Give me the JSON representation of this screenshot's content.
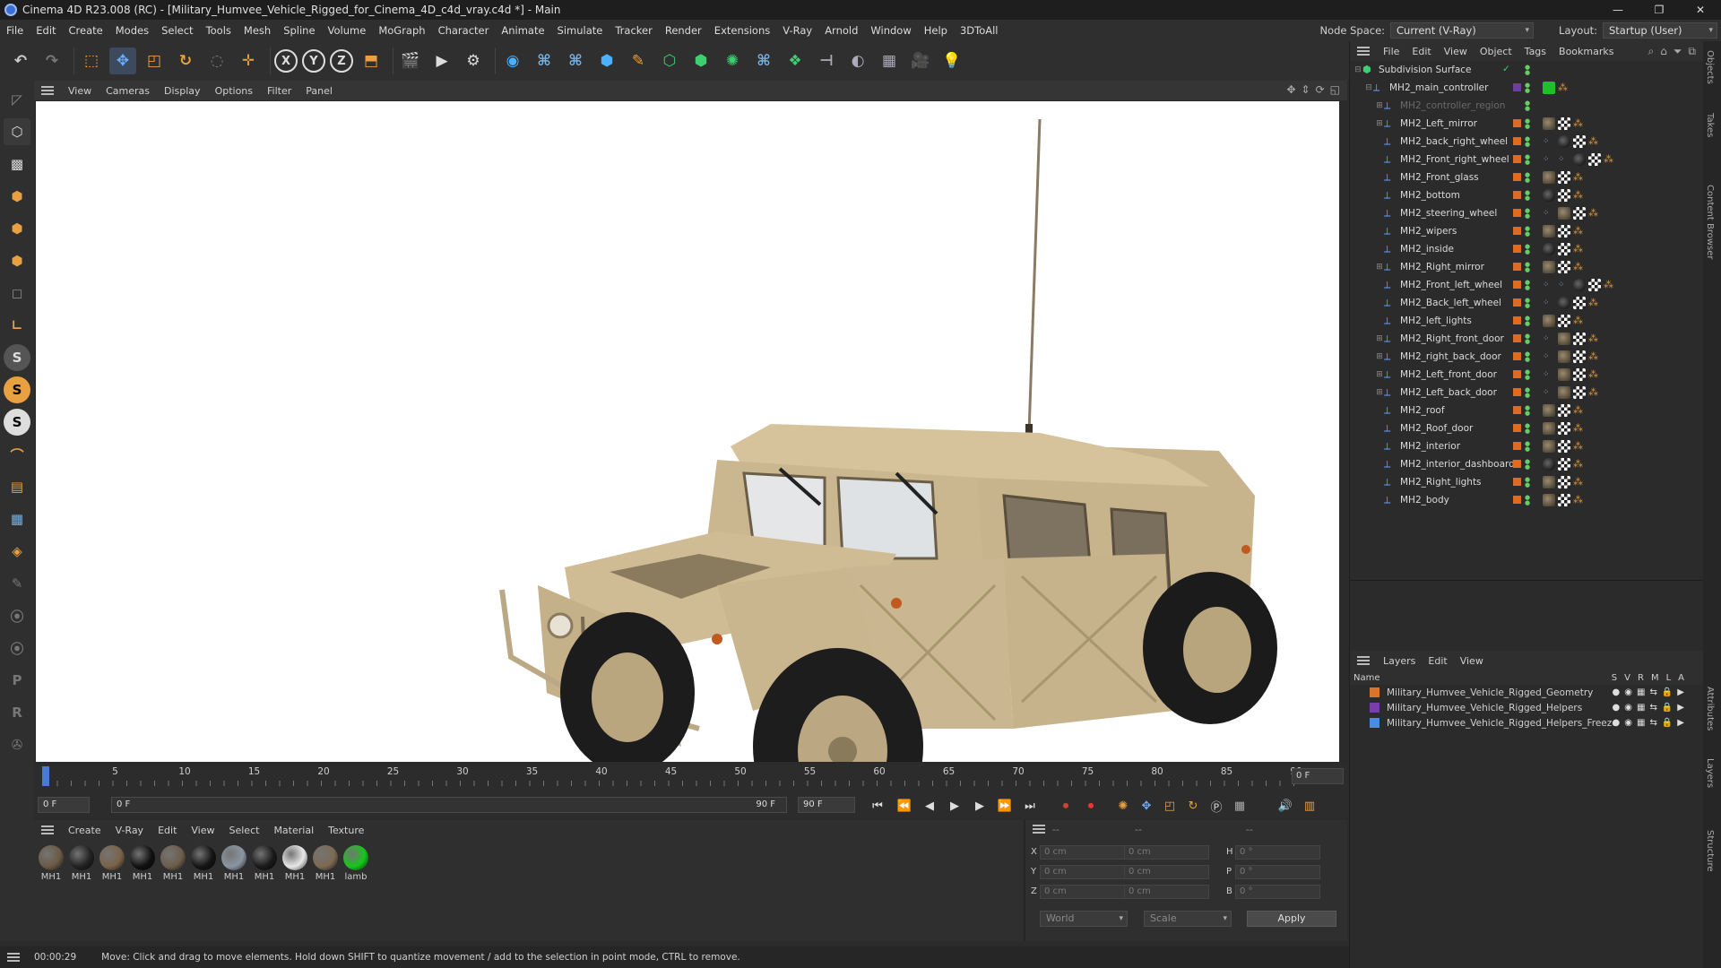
{
  "window": {
    "title": "Cinema 4D R23.008 (RC) - [Military_Humvee_Vehicle_Rigged_for_Cinema_4D_c4d_vray.c4d *] - Main"
  },
  "menu": [
    "File",
    "Edit",
    "Create",
    "Modes",
    "Select",
    "Tools",
    "Mesh",
    "Spline",
    "Volume",
    "MoGraph",
    "Character",
    "Animate",
    "Simulate",
    "Tracker",
    "Render",
    "Extensions",
    "V-Ray",
    "Arnold",
    "Window",
    "Help",
    "3DToAll"
  ],
  "node_space": {
    "label": "Node Space:",
    "value": "Current (V-Ray)"
  },
  "layout": {
    "label": "Layout:",
    "value": "Startup (User)"
  },
  "viewport_menu": [
    "View",
    "Cameras",
    "Display",
    "Options",
    "Filter",
    "Panel"
  ],
  "timeline": {
    "ticks": [
      "0",
      "5",
      "10",
      "15",
      "20",
      "25",
      "30",
      "35",
      "40",
      "45",
      "50",
      "55",
      "60",
      "65",
      "70",
      "75",
      "80",
      "85",
      "90"
    ],
    "frame": "0 F"
  },
  "playback": {
    "start": "0 F",
    "current": "0 F",
    "end_slider": "90 F",
    "end": "90 F"
  },
  "material_menu": [
    "Create",
    "V-Ray",
    "Edit",
    "View",
    "Select",
    "Material",
    "Texture"
  ],
  "materials": [
    {
      "label": "MH1",
      "color": "#6b5a45"
    },
    {
      "label": "MH1",
      "color": "#222"
    },
    {
      "label": "MH1",
      "color": "#7a6248"
    },
    {
      "label": "MH1",
      "color": "#111"
    },
    {
      "label": "MH1",
      "color": "#6d5d4b"
    },
    {
      "label": "MH1",
      "color": "#151515"
    },
    {
      "label": "MH1",
      "color": "#8a96a2"
    },
    {
      "label": "MH1",
      "color": "#1a1a1a"
    },
    {
      "label": "MH1",
      "color": "#e8e8e8"
    },
    {
      "label": "MH1",
      "color": "#7d6a52"
    },
    {
      "label": "lamb",
      "color": "#17c61c"
    }
  ],
  "coords": {
    "rows": [
      {
        "a1": "X",
        "v1": "0 cm",
        "a2": "X",
        "v2": "0 cm",
        "a3": "H",
        "v3": "0 °"
      },
      {
        "a1": "Y",
        "v1": "0 cm",
        "a2": "Y",
        "v2": "0 cm",
        "a3": "P",
        "v3": "0 °"
      },
      {
        "a1": "Z",
        "v1": "0 cm",
        "a2": "Z",
        "v2": "0 cm",
        "a3": "B",
        "v3": "0 °"
      }
    ],
    "head1": "--",
    "head2": "--",
    "head3": "--",
    "world": "World",
    "scale": "Scale",
    "apply": "Apply"
  },
  "status": {
    "time": "00:00:29",
    "message": "Move: Click and drag to move elements. Hold down SHIFT to quantize movement / add to the selection in point mode, CTRL to remove."
  },
  "object_menu": [
    "File",
    "Edit",
    "View",
    "Object",
    "Tags",
    "Bookmarks"
  ],
  "objects": [
    {
      "name": "Subdivision Surface",
      "indent": 0,
      "exp": "⊟",
      "sw": false,
      "tags": []
    },
    {
      "name": "MH2_main_controller",
      "indent": 1,
      "exp": "⊟",
      "sw": "#6a3fa0",
      "tags": [
        "green",
        "dot"
      ]
    },
    {
      "name": "MH2_controller_region",
      "indent": 2,
      "exp": "⊞",
      "sw": false,
      "dim": true,
      "tags": []
    },
    {
      "name": "MH2_Left_mirror",
      "indent": 2,
      "exp": "⊞",
      "tags": [
        "mat",
        "chk",
        "dot"
      ]
    },
    {
      "name": "MH2_back_right_wheel",
      "indent": 2,
      "exp": "",
      "tags": [
        "grid",
        "dark",
        "chk",
        "dot"
      ]
    },
    {
      "name": "MH2_Front_right_wheel",
      "indent": 2,
      "exp": "",
      "tags": [
        "grid",
        "grid",
        "dark",
        "chk",
        "dot"
      ]
    },
    {
      "name": "MH2_Front_glass",
      "indent": 2,
      "exp": "",
      "tags": [
        "mat",
        "chk",
        "dot"
      ]
    },
    {
      "name": "MH2_bottom",
      "indent": 2,
      "exp": "",
      "tags": [
        "dark",
        "chk",
        "dot"
      ]
    },
    {
      "name": "MH2_steering_wheel",
      "indent": 2,
      "exp": "",
      "tags": [
        "grid",
        "mat",
        "chk",
        "dot"
      ]
    },
    {
      "name": "MH2_wipers",
      "indent": 2,
      "exp": "",
      "tags": [
        "mat",
        "chk",
        "dot"
      ]
    },
    {
      "name": "MH2_inside",
      "indent": 2,
      "exp": "",
      "tags": [
        "dark",
        "chk",
        "dot"
      ]
    },
    {
      "name": "MH2_Right_mirror",
      "indent": 2,
      "exp": "⊞",
      "tags": [
        "mat",
        "chk",
        "dot"
      ]
    },
    {
      "name": "MH2_Front_left_wheel",
      "indent": 2,
      "exp": "",
      "tags": [
        "grid",
        "grid",
        "dark",
        "chk",
        "dot"
      ]
    },
    {
      "name": "MH2_Back_left_wheel",
      "indent": 2,
      "exp": "",
      "tags": [
        "grid",
        "dark",
        "chk",
        "dot"
      ]
    },
    {
      "name": "MH2_left_lights",
      "indent": 2,
      "exp": "",
      "tags": [
        "mat",
        "chk",
        "dot"
      ]
    },
    {
      "name": "MH2_Right_front_door",
      "indent": 2,
      "exp": "⊞",
      "tags": [
        "grid",
        "mat",
        "chk",
        "dot"
      ]
    },
    {
      "name": "MH2_right_back_door",
      "indent": 2,
      "exp": "⊞",
      "tags": [
        "grid",
        "mat",
        "chk",
        "dot"
      ]
    },
    {
      "name": "MH2_Left_front_door",
      "indent": 2,
      "exp": "⊞",
      "tags": [
        "grid",
        "mat",
        "chk",
        "dot"
      ]
    },
    {
      "name": "MH2_Left_back_door",
      "indent": 2,
      "exp": "⊞",
      "tags": [
        "grid",
        "mat",
        "chk",
        "dot"
      ]
    },
    {
      "name": "MH2_roof",
      "indent": 2,
      "exp": "",
      "tags": [
        "mat",
        "chk",
        "dot"
      ]
    },
    {
      "name": "MH2_Roof_door",
      "indent": 2,
      "exp": "",
      "tags": [
        "mat",
        "chk",
        "dot"
      ]
    },
    {
      "name": "MH2_interior",
      "indent": 2,
      "exp": "",
      "tags": [
        "mat",
        "chk",
        "dot"
      ]
    },
    {
      "name": "MH2_interior_dashboard",
      "indent": 2,
      "exp": "",
      "tags": [
        "dark",
        "chk",
        "dot"
      ]
    },
    {
      "name": "MH2_Right_lights",
      "indent": 2,
      "exp": "",
      "tags": [
        "mat",
        "chk",
        "dot"
      ]
    },
    {
      "name": "MH2_body",
      "indent": 2,
      "exp": "",
      "tags": [
        "mat",
        "chk",
        "dot"
      ]
    }
  ],
  "layers_menu": [
    "Layers",
    "Edit",
    "View"
  ],
  "layers_header": {
    "name": "Name",
    "cols": [
      "S",
      "V",
      "R",
      "M",
      "L",
      "A"
    ]
  },
  "layers": [
    {
      "name": "Military_Humvee_Vehicle_Rigged_Geometry",
      "color": "#d8752b"
    },
    {
      "name": "Military_Humvee_Vehicle_Rigged_Helpers",
      "color": "#7a3ea8"
    },
    {
      "name": "Military_Humvee_Vehicle_Rigged_Helpers_Freeze",
      "color": "#4a8ce0"
    }
  ],
  "side_tabs": [
    "Objects",
    "Takes",
    "Content Browser",
    "Attributes",
    "Layers",
    "Structure"
  ]
}
